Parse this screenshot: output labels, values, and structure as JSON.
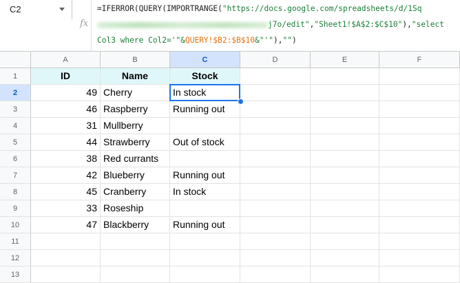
{
  "name_box": {
    "value": "C2"
  },
  "formula_bar": {
    "fx_label": "fx",
    "line1_a": "=IFERROR(QUERY(IMPORTRANGE(",
    "line1_b": "\"https://docs.google.com/spreadsheets/d/1Sq",
    "line2_a": "j7o/edit\"",
    "line2_b": ",",
    "line2_c": "\"Sheet1!$A$2:$C$10\"",
    "line2_d": "),",
    "line2_e": "\"select",
    "line3_a": "Col3 where Col2='\"&",
    "line3_b": "QUERY!$B2:$B$10",
    "line3_c": "&\"'\"",
    "line3_d": "),",
    "line3_e": "\"\"",
    "line3_f": ")"
  },
  "grid": {
    "columns": [
      "A",
      "B",
      "C",
      "D",
      "E",
      "F"
    ],
    "rows": [
      "1",
      "2",
      "3",
      "4",
      "5",
      "6",
      "7",
      "8",
      "9",
      "10",
      "11",
      "12",
      "13"
    ],
    "header": {
      "a": "ID",
      "b": "Name",
      "c": "Stock"
    },
    "data": [
      {
        "id": "49",
        "name": "Cherry",
        "stock": "In stock"
      },
      {
        "id": "46",
        "name": "Raspberry",
        "stock": "Running out"
      },
      {
        "id": "31",
        "name": "Mullberry",
        "stock": ""
      },
      {
        "id": "44",
        "name": "Strawberry",
        "stock": "Out of stock"
      },
      {
        "id": "38",
        "name": "Red currants",
        "stock": ""
      },
      {
        "id": "42",
        "name": "Blueberry",
        "stock": "Running out"
      },
      {
        "id": "45",
        "name": "Cranberry",
        "stock": "In stock"
      },
      {
        "id": "33",
        "name": "Roseship",
        "stock": ""
      },
      {
        "id": "47",
        "name": "Blackberry",
        "stock": "Running out"
      }
    ]
  },
  "colors": {
    "header_fill": "#e0f7fa",
    "selection": "#1a73e8"
  }
}
